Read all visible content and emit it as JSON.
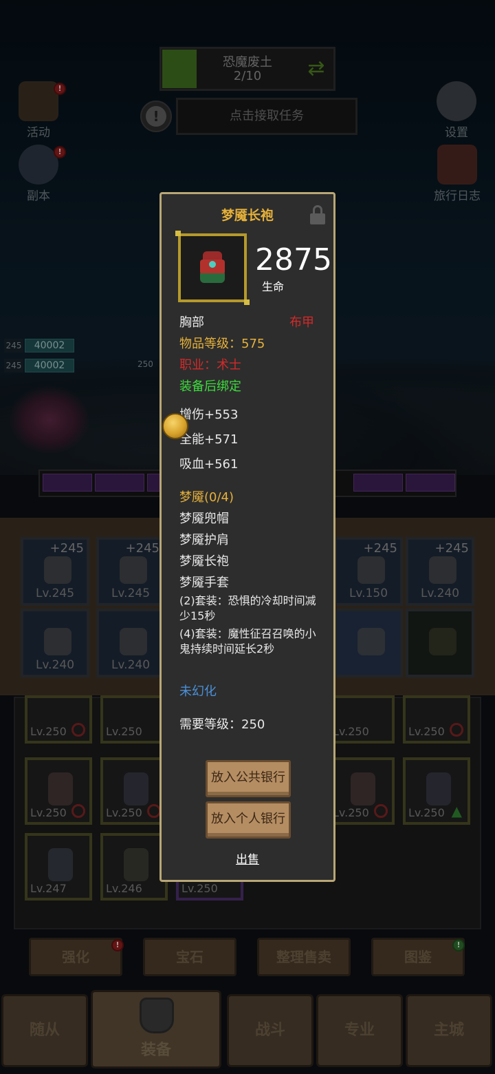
{
  "zone": {
    "name": "恐魔废土",
    "progress": "2/10",
    "progress_fraction": 0.2
  },
  "quest": {
    "prompt": "点击接取任务"
  },
  "side_buttons": {
    "activity": "活动",
    "dungeon": "副本",
    "settings": "设置",
    "journal": "旅行日志"
  },
  "party": [
    {
      "level": "245",
      "hp": "40002"
    },
    {
      "level": "245",
      "hp": "40002"
    }
  ],
  "enemy_level": "250",
  "equipped": [
    {
      "plus": "+245",
      "level": "Lv.245"
    },
    {
      "plus": "+245",
      "level": "Lv.245"
    },
    {
      "plus": "+245",
      "level": "Lv.150"
    },
    {
      "plus": "+245",
      "level": "Lv.240"
    },
    {
      "plus": "",
      "level": "Lv.240"
    },
    {
      "plus": "",
      "level": "Lv.240"
    }
  ],
  "bag": [
    {
      "level": "Lv.250",
      "restricted": true
    },
    {
      "level": "Lv.250",
      "restricted": false
    },
    {
      "level": "Lv.250",
      "restricted": false
    },
    {
      "level": "Lv.250",
      "restricted": true
    },
    {
      "level": "Lv.250",
      "restricted": true
    },
    {
      "level": "Lv.250",
      "restricted": true
    },
    {
      "level": "Lv.250",
      "restricted": true
    },
    {
      "level": "Lv.250",
      "upgrade": true
    },
    {
      "level": "Lv.247"
    },
    {
      "level": "Lv.246"
    },
    {
      "level": "Lv.250"
    }
  ],
  "tabs": {
    "enhance": "强化",
    "gems": "宝石",
    "sort_sell": "整理售卖",
    "codex": "图鉴"
  },
  "nav": {
    "followers": "随从",
    "equipment": "装备",
    "combat": "战斗",
    "profession": "专业",
    "main_city": "主城"
  },
  "item": {
    "name": "梦魇长袍",
    "primary_stat_value": "2875",
    "primary_stat_name": "生命",
    "slot": "胸部",
    "armor_type": "布甲",
    "item_level": "物品等级：575",
    "class_req": "职业：术士",
    "bind": "装备后绑定",
    "stats": [
      "增伤+553",
      "全能+571",
      "吸血+561"
    ],
    "set_name": "梦魇(0/4)",
    "set_pieces": [
      "梦魇兜帽",
      "梦魇护肩",
      "梦魇长袍",
      "梦魇手套"
    ],
    "set_bonus_2": "(2)套装：恐惧的冷却时间减少15秒",
    "set_bonus_4": "(4)套装：魔性征召召唤的小鬼持续时间延长2秒",
    "transmog": "未幻化",
    "required_level": "需要等级：250",
    "actions": {
      "public_bank": "放入公共银行",
      "personal_bank": "放入个人银行",
      "sell": "出售"
    }
  },
  "colors": {
    "title_gold": "#e6b13a",
    "class_red": "#d22a2a",
    "bind_green": "#3ddc3d",
    "transmog_blue": "#4a90d9",
    "popup_border": "#b9a776"
  }
}
